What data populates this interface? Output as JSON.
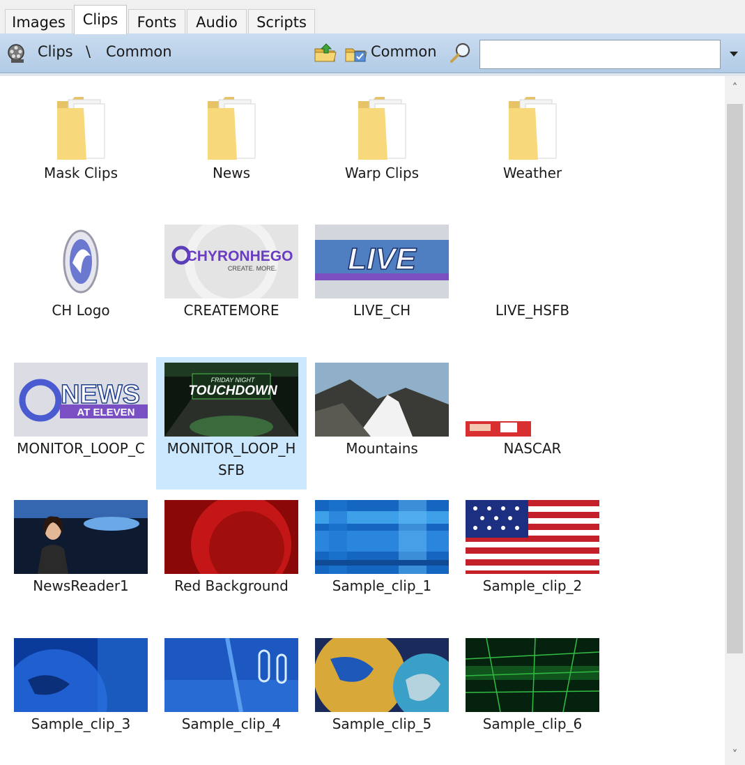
{
  "tabs": [
    "Images",
    "Clips",
    "Fonts",
    "Audio",
    "Scripts"
  ],
  "active_tab": "Clips",
  "toolbar": {
    "root_icon": "film-reel-icon",
    "breadcrumb": [
      "Clips",
      "\\",
      "Common"
    ],
    "folder_up_icon": "folder-up-icon",
    "folder_check_icon": "folder-check-icon",
    "current_folder": "Common",
    "search_icon": "magnifier-icon",
    "search_value": "",
    "dropdown_icon": "dropdown-arrow-icon"
  },
  "items": [
    {
      "label": "Mask Clips",
      "kind": "folder",
      "visual": "folder"
    },
    {
      "label": "News",
      "kind": "folder",
      "visual": "folder"
    },
    {
      "label": "Warp Clips",
      "kind": "folder",
      "visual": "folder"
    },
    {
      "label": "Weather",
      "kind": "folder",
      "visual": "folder"
    },
    {
      "label": "CH Logo",
      "kind": "clip",
      "visual": "ch-logo"
    },
    {
      "label": "CREATEMORE",
      "kind": "clip",
      "visual": "chyronhego",
      "thumb_text": [
        "CHYRONHEGO",
        "CREATE. MORE."
      ]
    },
    {
      "label": "LIVE_CH",
      "kind": "clip",
      "visual": "live",
      "thumb_text": [
        "LIVE"
      ]
    },
    {
      "label": "LIVE_HSFB",
      "kind": "clip",
      "visual": "blank"
    },
    {
      "label": "MONITOR_LOOP_C",
      "kind": "clip",
      "visual": "news-eleven",
      "thumb_text": [
        "NEWS",
        "AT ELEVEN"
      ]
    },
    {
      "label": "MONITOR_LOOP_H\nSFB",
      "kind": "clip",
      "visual": "touchdown",
      "selected": true,
      "thumb_text": [
        "FRIDAY NIGHT",
        "TOUCHDOWN"
      ]
    },
    {
      "label": "Mountains",
      "kind": "clip",
      "visual": "mountains"
    },
    {
      "label": "NASCAR",
      "kind": "clip",
      "visual": "nascar"
    },
    {
      "label": "NewsReader1",
      "kind": "clip",
      "visual": "newsreader"
    },
    {
      "label": "Red Background",
      "kind": "clip",
      "visual": "red"
    },
    {
      "label": "Sample_clip_1",
      "kind": "clip",
      "visual": "blue-stripes"
    },
    {
      "label": "Sample_clip_2",
      "kind": "clip",
      "visual": "flag"
    },
    {
      "label": "Sample_clip_3",
      "kind": "clip",
      "visual": "globe-blue"
    },
    {
      "label": "Sample_clip_4",
      "kind": "clip",
      "visual": "clips-blue"
    },
    {
      "label": "Sample_clip_5",
      "kind": "clip",
      "visual": "globe-gold"
    },
    {
      "label": "Sample_clip_6",
      "kind": "clip",
      "visual": "green-grid"
    }
  ],
  "scrollbar": {
    "up_icon": "scroll-up-icon",
    "down_icon": "scroll-down-icon"
  },
  "colors": {
    "toolbar": "#bfd5ec",
    "selection": "#cce8ff",
    "folder": "#f7d97c"
  }
}
